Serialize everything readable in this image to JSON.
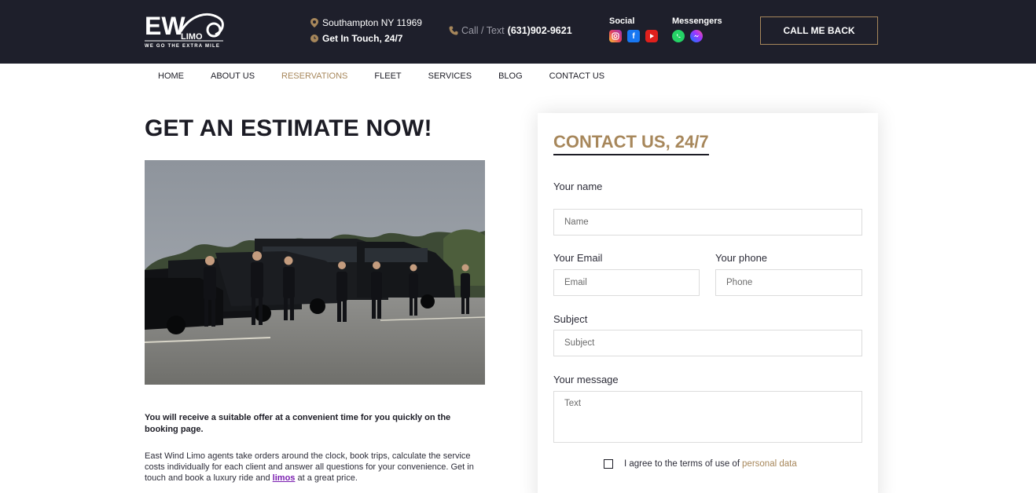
{
  "header": {
    "logo": {
      "text": "EW",
      "sub": "LIMO",
      "slogan": "WE GO THE EXTRA MILE"
    },
    "location": "Southampton NY 11969",
    "hours": "Get In Touch, 24/7",
    "call_label": "Call / Text",
    "phone": "(631)902-9621",
    "social_title": "Social",
    "social_icons": [
      "instagram-icon",
      "facebook-icon",
      "youtube-icon"
    ],
    "messengers_title": "Messengers",
    "messenger_icons": [
      "whatsapp-icon",
      "messenger-icon"
    ],
    "callback_label": "CALL ME BACK",
    "accent_color": "#a7875b",
    "bar_color": "#1e1f2b"
  },
  "nav": {
    "items": [
      {
        "label": "HOME"
      },
      {
        "label": "ABOUT US"
      },
      {
        "label": "RESERVATIONS",
        "active": true
      },
      {
        "label": "FLEET"
      },
      {
        "label": "SERVICES"
      },
      {
        "label": "BLOG"
      },
      {
        "label": "CONTACT US"
      }
    ]
  },
  "main": {
    "title": "GET AN ESTIMATE NOW!",
    "lead": "You will receive a suitable offer at a convenient time for you quickly on the booking page.",
    "desc_before": "East Wind Limo agents take orders around the clock, book trips, calculate the service costs individually for each client and answer all questions for your convenience. Get in touch and book a luxury ride and ",
    "desc_link": "limos",
    "desc_after": " at a great price."
  },
  "form": {
    "title": "CONTACT US, 24/7",
    "name_label": "Your name",
    "name_placeholder": "Name",
    "email_label": "Your Email",
    "email_placeholder": "Email",
    "phone_label": "Your phone",
    "phone_placeholder": "Phone",
    "subject_label": "Subject",
    "subject_placeholder": "Subject",
    "message_label": "Your message",
    "message_placeholder": "Text",
    "agree_text": "I agree to the terms of use of",
    "agree_link": "personal data"
  }
}
